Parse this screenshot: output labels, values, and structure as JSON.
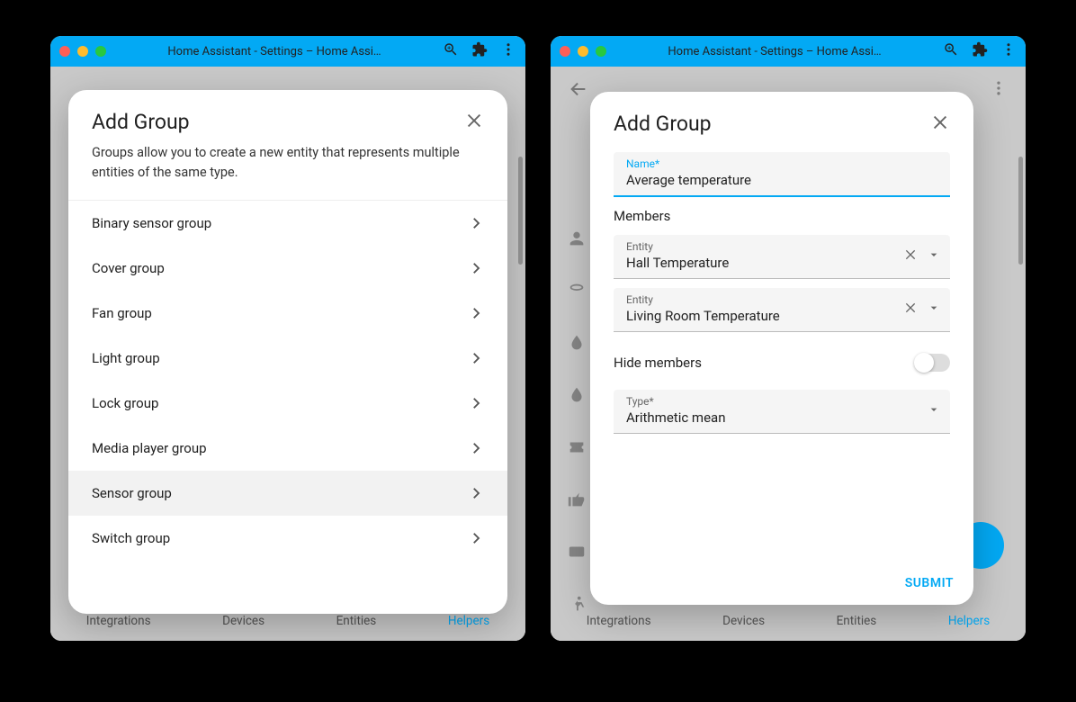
{
  "titlebar": {
    "title": "Home Assistant - Settings – Home Assi…"
  },
  "dialog_left": {
    "title": "Add Group",
    "description": "Groups allow you to create a new entity that represents multiple entities of the same type.",
    "options": [
      "Binary sensor group",
      "Cover group",
      "Fan group",
      "Light group",
      "Lock group",
      "Media player group",
      "Sensor group",
      "Switch group"
    ]
  },
  "dialog_right": {
    "title": "Add Group",
    "name_label": "Name*",
    "name_value": "Average temperature",
    "members_label": "Members",
    "entity_label": "Entity",
    "entities": [
      "Hall Temperature",
      "Living Room Temperature"
    ],
    "hide_members_label": "Hide members",
    "type_label": "Type*",
    "type_value": "Arithmetic mean",
    "submit_label": "Submit"
  },
  "tabs": {
    "items": [
      "Integrations",
      "Devices",
      "Entities",
      "Helpers"
    ],
    "active": "Helpers"
  }
}
